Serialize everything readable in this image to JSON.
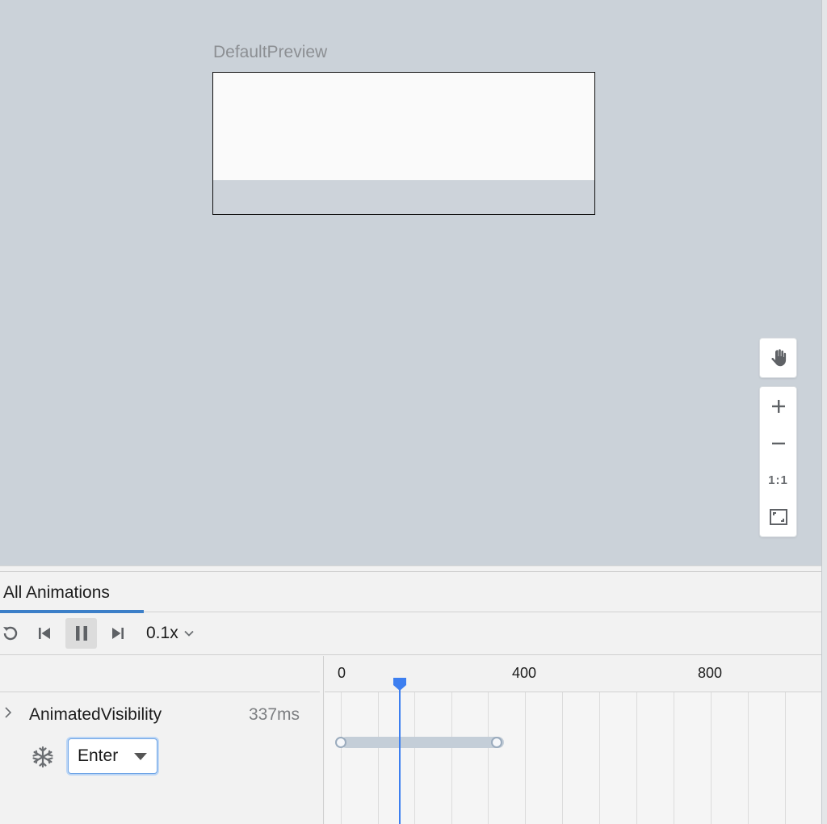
{
  "preview": {
    "label": "DefaultPreview"
  },
  "toolbar": {
    "pan_icon": "hand-icon",
    "zoom_in_icon": "plus-icon",
    "zoom_out_icon": "minus-icon",
    "actual_size_label": "1:1",
    "fit_icon": "fit-screen-icon"
  },
  "panel": {
    "tab_label": "All Animations",
    "controls": {
      "loop_icon": "loop-icon",
      "step_back_icon": "step-back-icon",
      "pause_icon": "pause-icon",
      "step_forward_icon": "step-forward-icon",
      "speed_value": "0.1x"
    },
    "animation": {
      "name": "AnimatedVisibility",
      "duration": "337ms",
      "state": "Enter",
      "freeze_icon": "freeze-icon"
    },
    "timeline": {
      "ticks": [
        "0",
        "400",
        "800"
      ],
      "playhead_ms": 122,
      "bar_start_ms": 0,
      "bar_end_ms": 337
    }
  },
  "colors": {
    "canvas_bg": "#cbd2d9",
    "accent": "#3d7ff0",
    "tab_underline": "#3c7fc8"
  }
}
